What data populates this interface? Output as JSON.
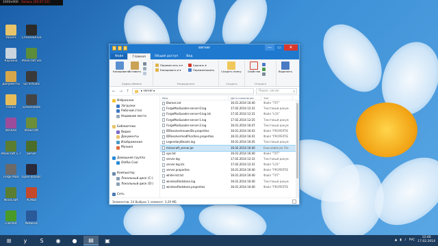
{
  "recorder": {
    "res": "1600x900",
    "text": "Запись [00:07:22]"
  },
  "desktop_icons": [
    {
      "label": "Valuers",
      "color": "#e8c46a"
    },
    {
      "label": "ChromeDriver",
      "color": "#2b2b2b"
    },
    {
      "label": "Корзина",
      "color": "#c9d4de"
    },
    {
      "label": "Minecraft Server",
      "color": "#5b8c3a"
    },
    {
      "label": "Документы",
      "color": "#d6a64b"
    },
    {
      "label": "SD Virtuals",
      "color": "#3a3a3a"
    },
    {
      "label": "Папка",
      "color": "#e6bd5a"
    },
    {
      "label": "Screenshots",
      "color": "#444"
    },
    {
      "label": "WinRAR",
      "color": "#9b4d9c"
    },
    {
      "label": "Minecraft",
      "color": "#6b8e3a"
    },
    {
      "label": "Minecraft 1.7",
      "color": "#5b7d32"
    },
    {
      "label": "Server",
      "color": "#4b6d2a"
    },
    {
      "label": "Forge Mod",
      "color": "#6a6a6a"
    },
    {
      "label": "Open Broadcast",
      "color": "#2a2a3a"
    },
    {
      "label": "MineCraft",
      "color": "#5b7d32"
    },
    {
      "label": "PCMan",
      "color": "#c4492a"
    },
    {
      "label": "uTorrent",
      "color": "#4a9a2a"
    },
    {
      "label": "Network",
      "color": "#2a5a9a"
    }
  ],
  "window": {
    "title": "server",
    "tabs": [
      "Файл",
      "Главная",
      "Общий доступ",
      "Вид"
    ],
    "ribbon": {
      "copy": "Копировать",
      "paste": "Вставить",
      "clip_small": [
        "",
        "",
        ""
      ],
      "clip_group": "Буфер обмена",
      "move": "Переместить в ▾",
      "copyto": "Копировать в ▾",
      "delete": "Удалить ▾",
      "rename": "Переименовать",
      "org_group": "Упорядочить",
      "newfolder": "Создать папку",
      "new_group": "Создать",
      "props": "Свойства",
      "open_group": "Открыть",
      "select": "Выделить",
      "select_group": ""
    },
    "path": "▸ server ▸",
    "search_placeholder": "Поиск: server",
    "nav": [
      {
        "label": "Избранное",
        "color": "#f3c53a"
      },
      {
        "label": "Загрузки",
        "color": "#3a78c4"
      },
      {
        "label": "Рабочий стол",
        "color": "#3a78c4"
      },
      {
        "label": "Недавние места",
        "color": "#9aa9b8"
      },
      {
        "label": "",
        "color": "transparent"
      },
      {
        "label": "Библиотеки",
        "color": "#e8c46a"
      },
      {
        "label": "Видео",
        "color": "#7b6ac4"
      },
      {
        "label": "Документы",
        "color": "#e8c46a"
      },
      {
        "label": "Изображения",
        "color": "#4a9ac4"
      },
      {
        "label": "Музыка",
        "color": "#e06a3a"
      },
      {
        "label": "",
        "color": "transparent"
      },
      {
        "label": "Домашняя группа",
        "color": "#2a8ad4"
      },
      {
        "label": "Olefka Cool",
        "color": "#2a8ad4"
      },
      {
        "label": "",
        "color": "transparent"
      },
      {
        "label": "Компьютер",
        "color": "#6a8aa8"
      },
      {
        "label": "Локальный диск (C:)",
        "color": "#8aa0b4"
      },
      {
        "label": "Локальный диск (D:)",
        "color": "#8aa0b4"
      },
      {
        "label": "",
        "color": "transparent"
      },
      {
        "label": "Сеть",
        "color": "#4a7ab4"
      }
    ],
    "cols": [
      "Имя",
      "Дата изменения",
      "Тип"
    ],
    "files": [
      {
        "name": "Biomes.txt",
        "date": "16.01.2014 16:40",
        "type": "Файл \"TXT\""
      },
      {
        "name": "ForgeModLoader-server-0.log",
        "date": "17.02.2014 12:31",
        "type": "Текстовый докум"
      },
      {
        "name": "ForgeModLoader-server-0.log.lck",
        "date": "17.02.2014 12:31",
        "type": "Файл \"LCK\""
      },
      {
        "name": "ForgeModLoader-server-1.log",
        "date": "17.02.2014 12:25",
        "type": "Текстовый докум"
      },
      {
        "name": "ForgeModLoader-server-2.log",
        "date": "16.01.2014 16:47",
        "type": "Текстовый докум"
      },
      {
        "name": "IDResolverknownIDs.properties",
        "date": "16.01.2014 16:41",
        "type": "Файл \"PROPERTIE"
      },
      {
        "name": "IDResolvermodPriorities.properties",
        "date": "16.01.2014 16:41",
        "type": "Файл \"PROPERTIE"
      },
      {
        "name": "LegendaryBeasts.log",
        "date": "16.01.2014 16:45",
        "type": "Текстовый докум"
      },
      {
        "name": "minecraft_server.jar",
        "date": "16.02.2014 16:40",
        "type": "Executable Jar File"
      },
      {
        "name": "ops.txt",
        "date": "16.01.2014 16:40",
        "type": "Файл \"TXT\""
      },
      {
        "name": "server.log",
        "date": "17.02.2014 12:31",
        "type": "Текстовый докум"
      },
      {
        "name": "server.log.lck",
        "date": "17.02.2014 12:31",
        "type": "Файл \"LCK\""
      },
      {
        "name": "server.properties",
        "date": "16.01.2014 16:40",
        "type": "Файл \"PROPERTIE"
      },
      {
        "name": "white-list.txt",
        "date": "16.01.2014 16:40",
        "type": "Файл \"TXT\""
      },
      {
        "name": "wirelessRedstone.log",
        "date": "16.01.2014 16:40",
        "type": "Текстовый докум"
      },
      {
        "name": "wirelessRedstone.properties",
        "date": "16.01.2014 16:40",
        "type": "Файл \"PROPERTIE"
      }
    ],
    "selected_index": 8,
    "status": "Элементов: 24    Выбран 1 элемент: 3,29 МБ"
  },
  "taskbar": {
    "items": [
      {
        "glyph": "⊞",
        "name": "start-button"
      },
      {
        "glyph": "y",
        "name": "yandex-browser"
      },
      {
        "glyph": "S",
        "name": "skype"
      },
      {
        "glyph": "◉",
        "name": "media-player"
      },
      {
        "glyph": "●",
        "name": "recorder"
      },
      {
        "glyph": "▤",
        "name": "explorer"
      },
      {
        "glyph": "▣",
        "name": "minecraft"
      }
    ],
    "lang": "РУС",
    "time": "12:46",
    "date": "17.02.2014"
  }
}
